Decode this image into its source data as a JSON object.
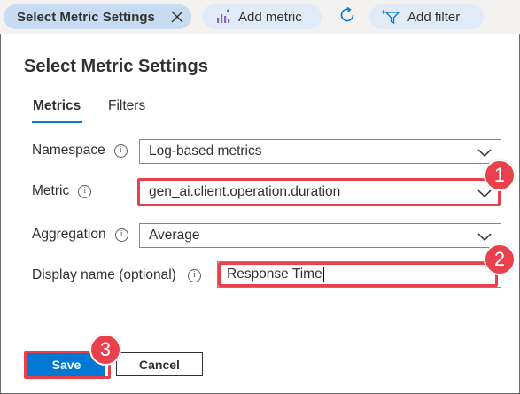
{
  "toolbar": {
    "active_tab_label": "Select Metric Settings",
    "add_metric_label": "Add metric",
    "add_filter_label": "Add filter"
  },
  "panel": {
    "title": "Select Metric Settings",
    "tabs": [
      {
        "label": "Metrics",
        "active": true
      },
      {
        "label": "Filters",
        "active": false
      }
    ]
  },
  "form": {
    "namespace": {
      "label": "Namespace",
      "value": "Log-based metrics"
    },
    "metric": {
      "label": "Metric",
      "value": "gen_ai.client.operation.duration"
    },
    "aggregation": {
      "label": "Aggregation",
      "value": "Average"
    },
    "display_name": {
      "label": "Display name (optional)",
      "value": "Response Time"
    }
  },
  "buttons": {
    "save_label": "Save",
    "cancel_label": "Cancel"
  },
  "callouts": [
    "1",
    "2",
    "3"
  ],
  "colors": {
    "accent": "#0078d4",
    "callout": "#e8414c",
    "active_pill": "#c7dbf2",
    "pill": "#e1ebf7"
  },
  "icons": {
    "close": "close-icon",
    "add_metric": "add-metric-icon",
    "refresh": "refresh-icon",
    "add_filter": "add-filter-icon",
    "info": "info-icon",
    "chevron": "chevron-down-icon"
  }
}
